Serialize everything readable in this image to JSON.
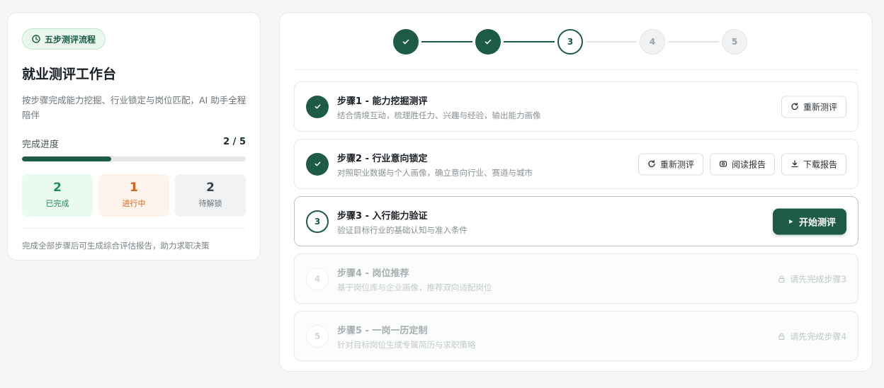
{
  "colors": {
    "primary": "#1e5a48",
    "done": "#1e8a5a",
    "in_progress": "#d9621c",
    "muted": "#9aa1a5"
  },
  "sidebar": {
    "tag_icon": "clock-icon",
    "tag": "五步测评流程",
    "title": "就业测评工作台",
    "subtitle": "按步骤完成能力挖掘、行业锁定与岗位匹配，AI 助手全程陪伴",
    "progress_label": "完成进度",
    "progress_value": "2 / 5",
    "progress_fraction": 0.4,
    "stats": [
      {
        "value": "2",
        "label": "已完成"
      },
      {
        "value": "1",
        "label": "进行中"
      },
      {
        "value": "2",
        "label": "待解锁"
      }
    ],
    "footer": "完成全部步骤后可生成综合评估报告，助力求职决策"
  },
  "stepper": {
    "nodes": [
      {
        "state": "done",
        "label": ""
      },
      {
        "state": "done",
        "label": ""
      },
      {
        "state": "current",
        "label": "3"
      },
      {
        "state": "todo",
        "label": "4"
      },
      {
        "state": "todo",
        "label": "5"
      }
    ]
  },
  "steps": [
    {
      "state": "done",
      "number": "",
      "title": "步骤1 - 能力挖掘测评",
      "desc": "结合情境互动，梳理胜任力、兴趣与经验，输出能力画像",
      "actions": [
        {
          "icon": "refresh-icon",
          "label": "重新测评"
        }
      ]
    },
    {
      "state": "done",
      "number": "",
      "title": "步骤2 - 行业意向锁定",
      "desc": "对照职业数据与个人画像，确立意向行业、赛道与城市",
      "actions": [
        {
          "icon": "refresh-icon",
          "label": "重新测评"
        },
        {
          "icon": "eye-icon",
          "label": "阅读报告"
        },
        {
          "icon": "download-icon",
          "label": "下载报告"
        }
      ]
    },
    {
      "state": "current",
      "number": "3",
      "title": "步骤3 - 入行能力验证",
      "desc": "验证目标行业的基础认知与准入条件",
      "primary_icon": "play-icon",
      "primary_label": "开始测评"
    },
    {
      "state": "locked",
      "number": "4",
      "title": "步骤4 - 岗位推荐",
      "desc": "基于岗位库与企业画像，推荐双向适配岗位",
      "lock_icon": "lock-icon",
      "lock_note": "请先完成步骤3"
    },
    {
      "state": "locked",
      "number": "5",
      "title": "步骤5 - 一岗一历定制",
      "desc": "针对目标岗位生成专属简历与求职策略",
      "lock_icon": "lock-icon",
      "lock_note": "请先完成步骤4"
    }
  ]
}
